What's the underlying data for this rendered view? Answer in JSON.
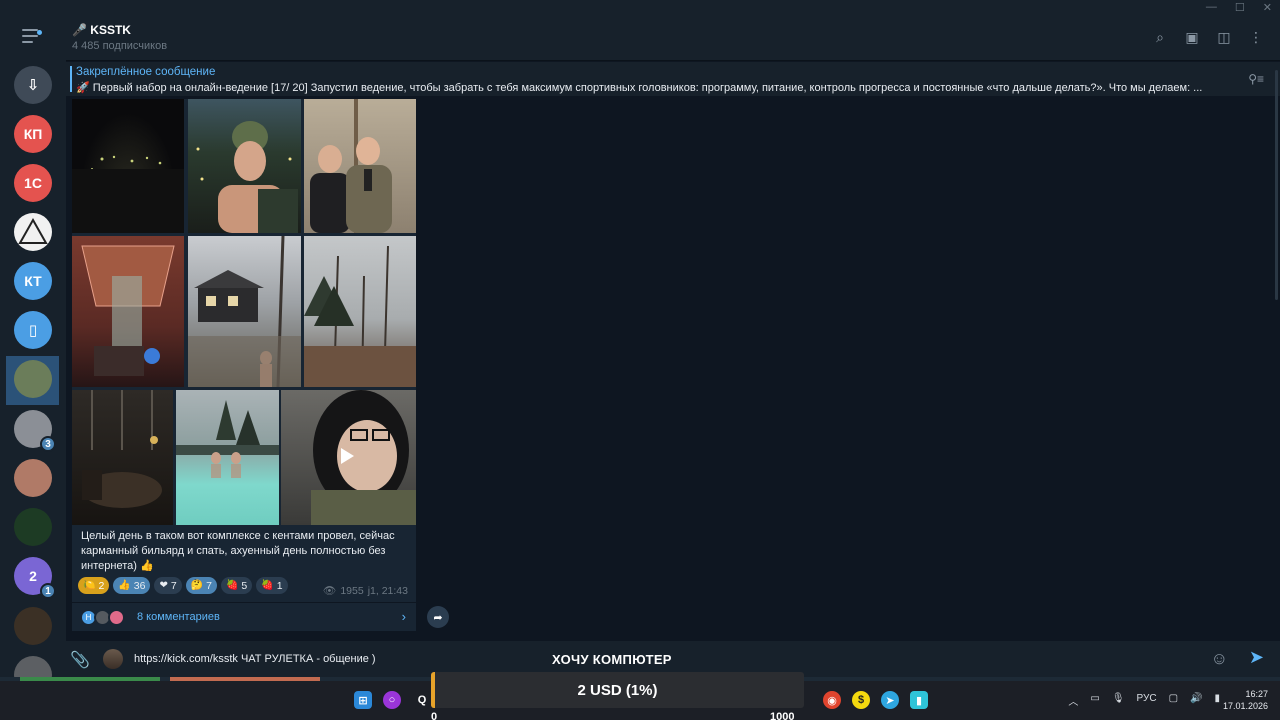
{
  "channel": {
    "title": "KSSTK",
    "subscribers": "4 485 подписчиков"
  },
  "pinned": {
    "title": "Закреплённое сообщение",
    "text": "🚀 Первый набор на онлайн-ведение [17/ 20]  Запустил ведение, чтобы забрать с тебя максимум спортивных головников: программу, питание, контроль прогресса и постоянные «что дальше делать?».  Что мы делаем: ..."
  },
  "sidebar": {
    "chats": [
      {
        "initials": "",
        "icon": "archive-icon",
        "color": "#3f4a57"
      },
      {
        "initials": "КП",
        "color": "#e4534f"
      },
      {
        "initials": "1С",
        "color": "#e4534f"
      },
      {
        "initials": "",
        "icon": "dark-triad-logo",
        "color": "#f1f1f1"
      },
      {
        "initials": "КТ",
        "color": "#4b9ee4"
      },
      {
        "initials": "",
        "icon": "bookmark-icon",
        "color": "#4b9ee4"
      },
      {
        "initials": "",
        "icon": "avatar",
        "color": "#6b7d5a"
      },
      {
        "initials": "",
        "icon": "avatar",
        "color": "#8b8f96",
        "badge": "3"
      },
      {
        "initials": "",
        "icon": "avatar",
        "color": "#b07a67"
      },
      {
        "initials": "",
        "icon": "ksstk-help-logo",
        "color": "#1d3b24"
      },
      {
        "initials": "2",
        "color": "#7a66d4",
        "badge": "1"
      },
      {
        "initials": "",
        "icon": "avatar",
        "color": "#3b3025"
      },
      {
        "initials": "",
        "icon": "avatar",
        "color": "#5c5f63"
      }
    ]
  },
  "message": {
    "caption": "Целый день в таком вот комплексе с кентами провел, сейчас карманный бильярд и спать, ахуенный день полностью без интернета) 👍",
    "reactions": [
      {
        "emoji": "🍋",
        "count": "2",
        "style": "gold"
      },
      {
        "emoji": "👍",
        "count": "36",
        "style": "mine"
      },
      {
        "emoji": "❤",
        "count": "7",
        "style": "normal"
      },
      {
        "emoji": "🤔",
        "count": "7",
        "style": "mine"
      },
      {
        "emoji": "🍓",
        "count": "5",
        "style": "normal"
      },
      {
        "emoji": "🍓",
        "count": "1",
        "style": "normal"
      }
    ],
    "views": "1955",
    "time": "j1, 21:43",
    "comments_label": "8 комментариев"
  },
  "input": {
    "text": "https://kick.com/ksstk ЧАТ РУЛЕТКА - общение )"
  },
  "overlay": {
    "title": "ХОЧУ КОМПЮТЕР",
    "amount": "2 USD (1%)",
    "min": "0",
    "max": "1000",
    "progress_percent": 1
  },
  "tray": {
    "lang": "РУС",
    "time": "16:27",
    "date": "17.01.2026"
  },
  "colors": {
    "accent": "#5eb5f7",
    "bg": "#0e1621",
    "panel": "#17212b",
    "bubble": "#182533"
  }
}
